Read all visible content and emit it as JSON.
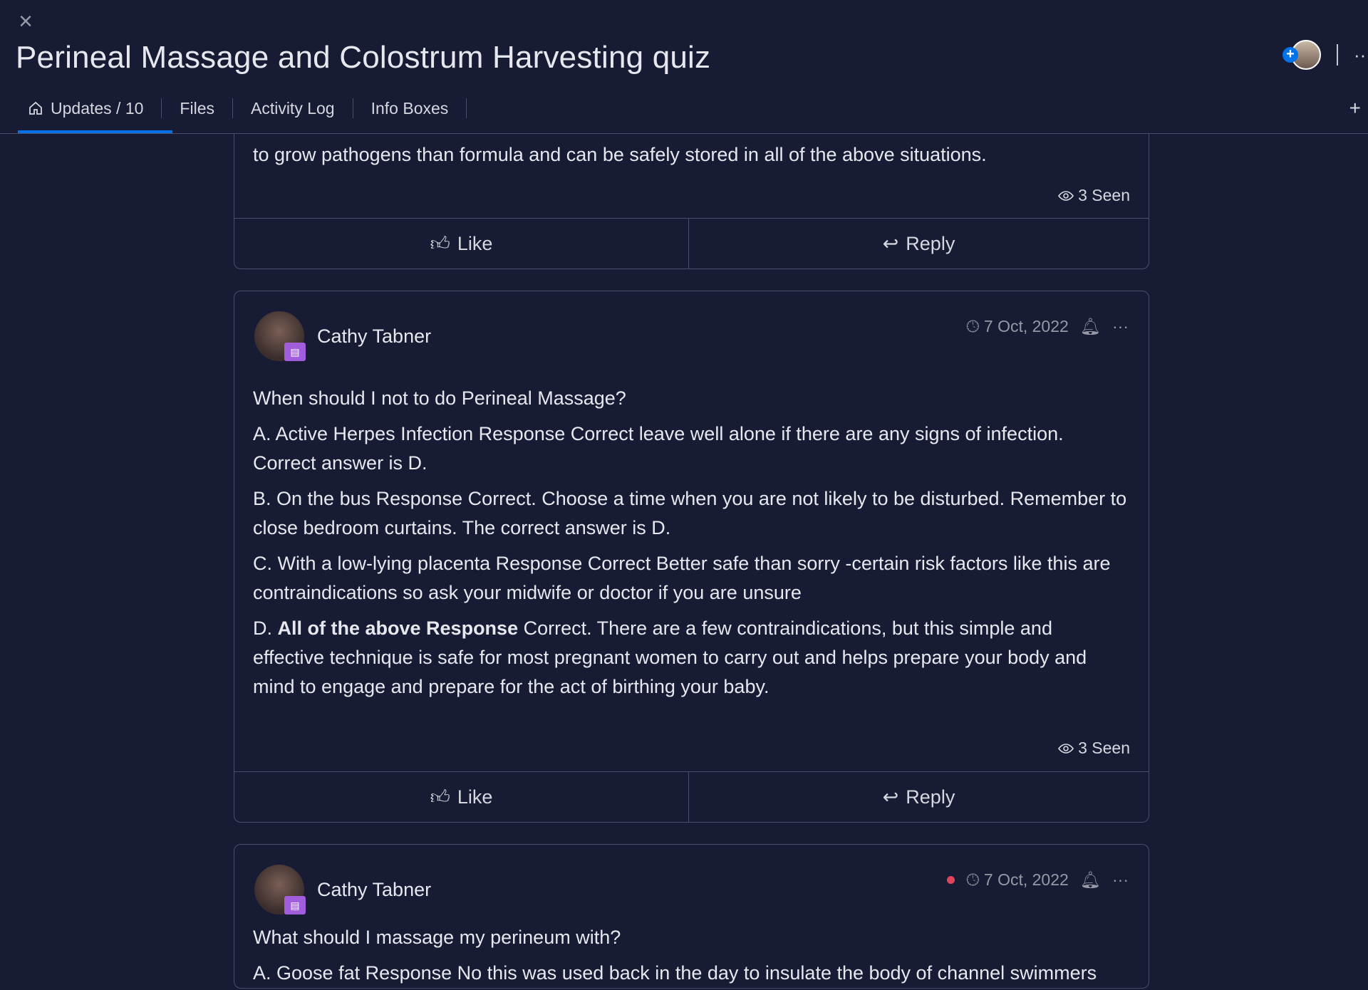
{
  "header": {
    "close_icon": "close-icon",
    "title": "Perineal Massage and Colostrum Harvesting quiz",
    "more_icon": "more-icon"
  },
  "tabs": [
    {
      "label": "Updates / 10",
      "icon": "home-icon",
      "active": true
    },
    {
      "label": "Files"
    },
    {
      "label": "Activity Log"
    },
    {
      "label": "Info Boxes"
    }
  ],
  "accent": "#0073ea",
  "posts": [
    {
      "partial_text": "to grow pathogens than formula and can be safely stored in all of the above situations.",
      "seen": "3 Seen",
      "like": "Like",
      "reply": "Reply"
    },
    {
      "author": "Cathy Tabner",
      "date": "7 Oct, 2022",
      "paragraphs": [
        {
          "text": "When should I not to do Perineal Massage?"
        },
        {
          "text": "A. Active Herpes Infection Response Correct leave well alone if there are any signs of infection. Correct answer is D."
        },
        {
          "text": "B. On the bus Response Correct. Choose a time when you are not likely to be disturbed. Remember to close bedroom curtains. The correct answer is D."
        },
        {
          "text": "C. With a low-lying placenta Response Correct Better safe than sorry -certain risk factors like this are contraindications so ask your midwife or doctor if you are unsure"
        },
        {
          "prefix": "D. ",
          "bold": "All of the above Response",
          "text": " Correct. There are a few contraindications, but this simple and effective technique is safe for most pregnant women to carry out and helps prepare your body and mind to engage and prepare for the act of birthing your baby."
        }
      ],
      "seen": "3 Seen",
      "like": "Like",
      "reply": "Reply"
    },
    {
      "author": "Cathy Tabner",
      "date": "7 Oct, 2022",
      "unread": true,
      "paragraphs": [
        {
          "text": "What should I massage my perineum with?"
        },
        {
          "text": "A. Goose fat Response No this was used back in the day to insulate the body of channel swimmers"
        }
      ]
    }
  ]
}
